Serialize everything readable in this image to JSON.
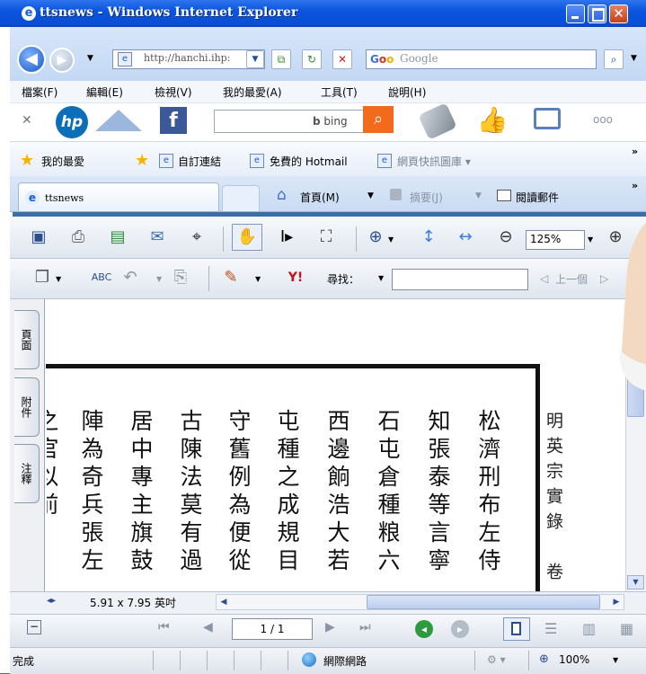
{
  "window": {
    "title": "ttsnews - Windows Internet Explorer"
  },
  "address": {
    "url": "http://hanchi.ihp:"
  },
  "search": {
    "placeholder": "Google"
  },
  "menu": [
    "檔案(F)",
    "編輯(E)",
    "檢視(V)",
    "我的最愛(A)",
    "工具(T)",
    "說明(H)"
  ],
  "bing": {
    "label": "bing"
  },
  "favorites": {
    "favorites_label": "我的最愛",
    "items": [
      "自訂連結",
      "免費的 Hotmail",
      "網頁快訊圖庫 ▾"
    ]
  },
  "tabs": {
    "active": "ttsnews",
    "home": "首頁(M)",
    "feeds": "摘要(J)",
    "read_mail": "閱讀郵件"
  },
  "pdf_toolbar": {
    "zoom": "125%",
    "find_label": "尋找：",
    "prev_label": "上一個"
  },
  "side_tabs": [
    "頁面",
    "附件",
    "注釋"
  ],
  "document": {
    "header": "明英宗實錄　卷",
    "columns": [
      "松濟刑布左侍",
      "知張泰等言寧",
      "石屯倉種粮六",
      "西邊餉浩大若",
      "屯種之成規目",
      "守舊例為便從",
      "古陳法莫有過",
      "居中專主旗鼓",
      "陣為奇兵張左",
      "之官以前"
    ]
  },
  "page_size": "5.91 x 7.95 英吋",
  "page_nav": {
    "current": "1 / 1"
  },
  "status": {
    "text": "完成",
    "zone": "網際網路",
    "zoom": "100%"
  }
}
